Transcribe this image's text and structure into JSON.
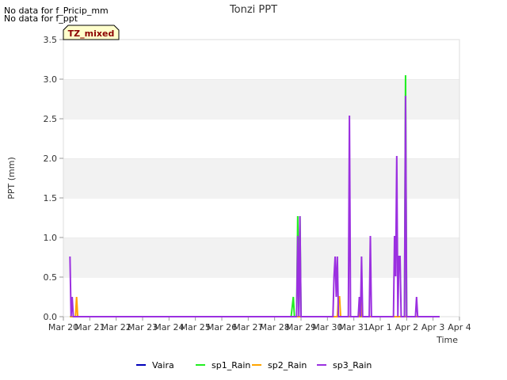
{
  "notes": [
    "No data for f_Pricip_mm",
    "No data for f_ppt"
  ],
  "badge": "TZ_mixed",
  "chart_data": {
    "type": "line",
    "title": "Tonzi PPT",
    "xlabel": "Time",
    "ylabel": "PPT (mm)",
    "xlim": [
      "2024-03-20",
      "2024-04-04"
    ],
    "ylim": [
      0,
      3.5
    ],
    "yticks": [
      0.0,
      0.5,
      1.0,
      1.5,
      2.0,
      2.5,
      3.0,
      3.5
    ],
    "ytick_labels": [
      "0.0",
      "0.5",
      "1.0",
      "1.5",
      "2.0",
      "2.5",
      "3.0",
      "3.5"
    ],
    "xtick_labels": [
      "Mar 20",
      "Mar 21",
      "Mar 22",
      "Mar 23",
      "Mar 24",
      "Mar 25",
      "Mar 26",
      "Mar 27",
      "Mar 28",
      "Mar 29",
      "Mar 30",
      "Mar 31",
      "Apr 1",
      "Apr 2",
      "Apr 3",
      "Apr 4"
    ],
    "grid": "horizontal bands",
    "legend_position": "bottom",
    "series": [
      {
        "name": "Vaira",
        "color": "#0000bb",
        "points": []
      },
      {
        "name": "sp1_Rain",
        "color": "#22ee22",
        "points": [
          [
            "2024-03-20T06:00",
            0
          ],
          [
            "2024-03-28T15:00",
            0
          ],
          [
            "2024-03-28T17:00",
            0.25
          ],
          [
            "2024-03-28T18:00",
            0
          ],
          [
            "2024-03-28T20:00",
            0
          ],
          [
            "2024-03-28T21:00",
            1.27
          ],
          [
            "2024-03-28T22:00",
            0.25
          ],
          [
            "2024-03-28T23:00",
            1.27
          ],
          [
            "2024-03-29T00:00",
            0
          ],
          [
            "2024-04-01T22:00",
            0
          ],
          [
            "2024-04-01T23:00",
            3.05
          ],
          [
            "2024-04-02T00:00",
            0
          ],
          [
            "2024-04-03T06:00",
            0
          ]
        ]
      },
      {
        "name": "sp2_Rain",
        "color": "#ffa500",
        "points": [
          [
            "2024-03-20T06:00",
            0
          ],
          [
            "2024-03-20T11:00",
            0
          ],
          [
            "2024-03-20T12:00",
            0.25
          ],
          [
            "2024-03-20T13:00",
            0
          ],
          [
            "2024-03-30T09:00",
            0
          ],
          [
            "2024-03-30T10:00",
            0.25
          ],
          [
            "2024-03-30T11:00",
            0.25
          ],
          [
            "2024-03-30T12:00",
            0
          ],
          [
            "2024-03-31T05:00",
            0
          ],
          [
            "2024-03-31T06:00",
            0.25
          ],
          [
            "2024-03-31T07:00",
            0
          ],
          [
            "2024-04-03T06:00",
            0
          ]
        ]
      },
      {
        "name": "sp3_Rain",
        "color": "#9b30e0",
        "points": [
          [
            "2024-03-20T06:00",
            0.76
          ],
          [
            "2024-03-20T07:00",
            0
          ],
          [
            "2024-03-20T08:00",
            0.25
          ],
          [
            "2024-03-20T09:00",
            0
          ],
          [
            "2024-03-28T20:00",
            0
          ],
          [
            "2024-03-28T21:00",
            1.02
          ],
          [
            "2024-03-28T22:00",
            0
          ],
          [
            "2024-03-28T23:00",
            1.27
          ],
          [
            "2024-03-29T00:00",
            0
          ],
          [
            "2024-03-30T05:00",
            0
          ],
          [
            "2024-03-30T06:00",
            0.51
          ],
          [
            "2024-03-30T07:00",
            0.76
          ],
          [
            "2024-03-30T08:00",
            0.25
          ],
          [
            "2024-03-30T09:00",
            0.76
          ],
          [
            "2024-03-30T10:00",
            0
          ],
          [
            "2024-03-30T19:00",
            0
          ],
          [
            "2024-03-30T20:00",
            2.54
          ],
          [
            "2024-03-30T21:00",
            0
          ],
          [
            "2024-03-31T04:00",
            0
          ],
          [
            "2024-03-31T05:00",
            0.25
          ],
          [
            "2024-03-31T06:00",
            0
          ],
          [
            "2024-03-31T07:00",
            0.76
          ],
          [
            "2024-03-31T08:00",
            0
          ],
          [
            "2024-03-31T14:00",
            0
          ],
          [
            "2024-03-31T15:00",
            1.02
          ],
          [
            "2024-03-31T16:00",
            0
          ],
          [
            "2024-04-01T12:00",
            0
          ],
          [
            "2024-04-01T13:00",
            1.02
          ],
          [
            "2024-04-01T14:00",
            0.51
          ],
          [
            "2024-04-01T15:00",
            2.03
          ],
          [
            "2024-04-01T16:00",
            0
          ],
          [
            "2024-04-01T17:00",
            0.76
          ],
          [
            "2024-04-01T18:00",
            0.76
          ],
          [
            "2024-04-01T19:00",
            0
          ],
          [
            "2024-04-01T22:00",
            0
          ],
          [
            "2024-04-01T23:00",
            2.79
          ],
          [
            "2024-04-02T00:00",
            0
          ],
          [
            "2024-04-02T08:00",
            0
          ],
          [
            "2024-04-02T09:00",
            0.25
          ],
          [
            "2024-04-02T10:00",
            0
          ],
          [
            "2024-04-03T06:00",
            0
          ]
        ]
      }
    ]
  }
}
